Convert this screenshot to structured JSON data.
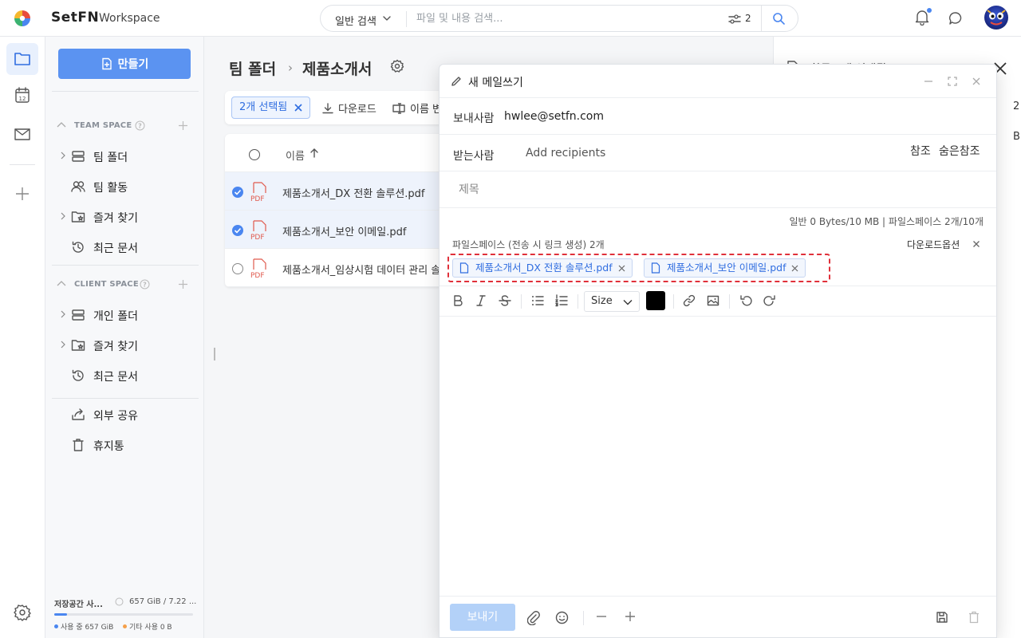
{
  "app": {
    "brand": "SetFN",
    "workspace": "Workspace"
  },
  "search": {
    "type_label": "일반 검색",
    "placeholder": "파일 및 내용 검색...",
    "filter_count": "2"
  },
  "sidebar": {
    "create_label": "만들기",
    "team_space": {
      "title": "TEAM SPACE",
      "items": [
        {
          "label": "팀 폴더",
          "icon": "server-icon"
        },
        {
          "label": "팀 활동",
          "icon": "users-icon"
        },
        {
          "label": "즐겨 찾기",
          "icon": "folder-star-icon"
        },
        {
          "label": "최근 문서",
          "icon": "history-icon"
        }
      ]
    },
    "client_space": {
      "title": "CLIENT SPACE",
      "items": [
        {
          "label": "개인 폴더",
          "icon": "server-icon"
        },
        {
          "label": "즐겨 찾기",
          "icon": "folder-star-icon"
        },
        {
          "label": "최근 문서",
          "icon": "history-icon"
        }
      ]
    },
    "extra": [
      {
        "label": "외부 공유",
        "icon": "share-icon"
      },
      {
        "label": "휴지통",
        "icon": "trash-icon"
      }
    ],
    "storage": {
      "title": "저장공간 사...",
      "value": "657 GiB / 7.22 ...",
      "fill_fraction": 0.09,
      "used": "사용 중 657 GiB",
      "other": "기타 사용 0 B",
      "used_color": "#4a86f0",
      "other_color": "#f5a04a"
    }
  },
  "main": {
    "breadcrumb": [
      "팀 폴더",
      "제품소개서"
    ],
    "selection_chip": "2개 선택됨",
    "download_label": "다운로드",
    "rename_label": "이름 변",
    "table": {
      "header_name": "이름",
      "rows": [
        {
          "name": "제품소개서_DX 전환 솔루션.pdf",
          "selected": true
        },
        {
          "name": "제품소개서_보안 이메일.pdf",
          "selected": true
        },
        {
          "name": "제품소개서_임상시험 데이터 관리 솔",
          "selected": false
        }
      ]
    }
  },
  "right_panel": {
    "title": "항목 2개 선택됨",
    "n1": "2",
    "n2": "B"
  },
  "compose": {
    "title": "새 메일쓰기",
    "from_label": "보내사람",
    "from_value": "hwlee@setfn.com",
    "to_label": "받는사람",
    "to_placeholder": "Add recipients",
    "cc_label": "참조",
    "bcc_label": "숨은참조",
    "subject_placeholder": "제목",
    "quota": "일반 0 Bytes/10 MB  |  파일스페이스 2개/10개",
    "attachments_label": "파일스페이스 (전송 시 링크 생성) 2개",
    "download_options": "다운로드옵션",
    "attachments": [
      "제품소개서_DX 전환 솔루션.pdf",
      "제품소개서_보안 이메일.pdf"
    ],
    "size_label": "Size",
    "send_label": "보내기",
    "text_color": "#000000"
  },
  "colors": {
    "accent": "#5b93f1",
    "highlight_border": "#e0303a",
    "send_disabled": "#b3d1f8"
  }
}
